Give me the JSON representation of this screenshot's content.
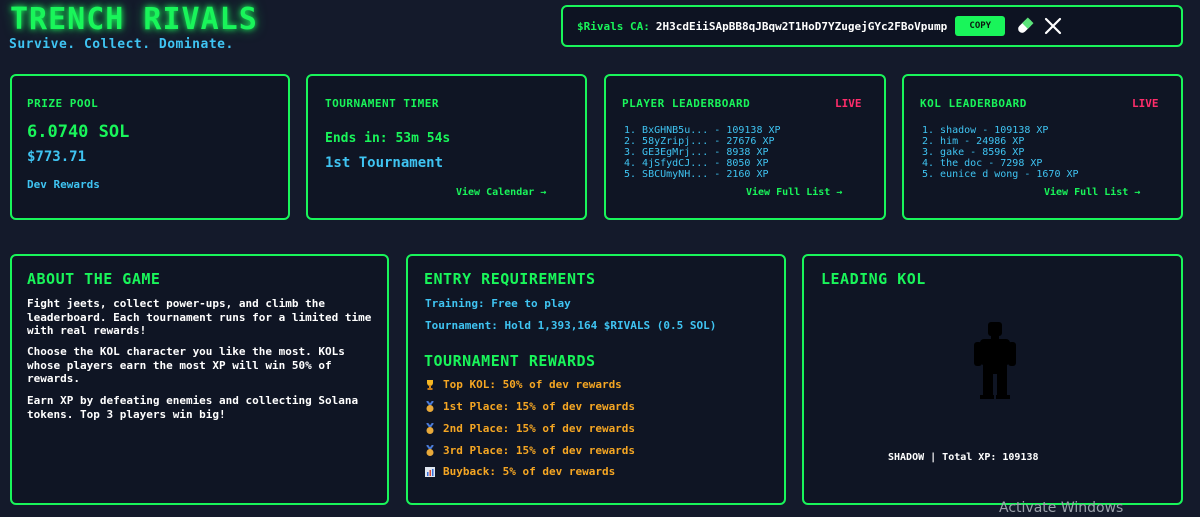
{
  "header": {
    "title": "TRENCH RIVALS",
    "subtitle": "Survive. Collect. Dominate.",
    "ca_label": "$Rivals CA:",
    "ca_value": "2H3cdEiiSApBB8qJBqw2T1HoD7YZugejGYc2FBoVpump",
    "copy_label": "COPY",
    "icons": [
      "pill-icon",
      "x-logo-icon"
    ]
  },
  "prize_pool": {
    "title": "PRIZE POOL",
    "sol": "6.0740 SOL",
    "usd": "$773.71",
    "caption": "Dev Rewards"
  },
  "timer": {
    "title": "TOURNAMENT TIMER",
    "ends": "Ends in: 53m 54s",
    "name": "1st Tournament",
    "link": "View Calendar →"
  },
  "player_board": {
    "title": "PLAYER LEADERBOARD",
    "live": "LIVE",
    "rows": [
      "1. BxGHNB5u... - 109138 XP",
      "2. 58yZripj... - 27676 XP",
      "3. GE3EgMrj... - 8938 XP",
      "4. 4jSfydCJ... - 8050 XP",
      "5. SBCUmyNH... - 2160 XP"
    ],
    "link": "View Full List →"
  },
  "kol_board": {
    "title": "KOL LEADERBOARD",
    "live": "LIVE",
    "rows": [
      "1. shadow - 109138 XP",
      "2. him - 24986 XP",
      "3. gake - 8596 XP",
      "4. the doc - 7298 XP",
      "5. eunice d wong - 1670 XP"
    ],
    "link": "View Full List →"
  },
  "about": {
    "title": "ABOUT THE GAME",
    "paragraphs": [
      "Fight jeets, collect power-ups, and climb the leaderboard. Each tournament runs for a limited time with real rewards!",
      "Choose the KOL character you like the most. KOLs whose players earn the most XP will win 50% of rewards.",
      "Earn XP by defeating enemies and collecting Solana tokens. Top 3 players win big!"
    ]
  },
  "entry": {
    "title": "ENTRY REQUIREMENTS",
    "training": "Training: Free to play",
    "tournament": "Tournament: Hold 1,393,164 $RIVALS (0.5 SOL)",
    "rewards_title": "TOURNAMENT REWARDS",
    "rewards": [
      {
        "icon": "trophy-icon",
        "text": "Top KOL: 50% of dev rewards"
      },
      {
        "icon": "medal-icon",
        "text": "1st Place: 15% of dev rewards"
      },
      {
        "icon": "medal-icon",
        "text": "2nd Place: 15% of dev rewards"
      },
      {
        "icon": "medal-icon",
        "text": "3rd Place: 15% of dev rewards"
      },
      {
        "icon": "chart-icon",
        "text": "Buyback: 5% of dev rewards"
      }
    ]
  },
  "leading_kol": {
    "title": "LEADING KOL",
    "caption": "SHADOW | Total XP: 109138"
  },
  "watermark": "Activate Windows",
  "colors": {
    "background": "#141a2b",
    "accent_green": "#19f55a",
    "cyan": "#3fc4f2",
    "orange": "#f5a623",
    "live_red": "#ff2d6b"
  }
}
